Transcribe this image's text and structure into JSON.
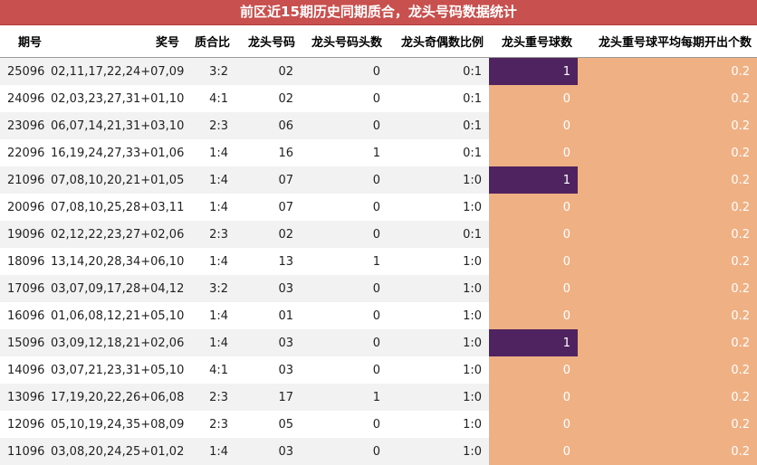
{
  "title": "前区近15期历史同期质合，龙头号码数据统计",
  "headers": [
    "期号",
    "奖号",
    "质合比",
    "龙头号码",
    "龙头号码头数",
    "龙头奇偶数比例",
    "龙头重号球数",
    "龙头重号球平均每期开出个数"
  ],
  "rows": [
    [
      "25096",
      "02,11,17,22,24+07,09",
      "3:2",
      "02",
      "0",
      "0:1",
      "1",
      "0.2"
    ],
    [
      "24096",
      "02,03,23,27,31+01,10",
      "4:1",
      "02",
      "0",
      "0:1",
      "0",
      "0.2"
    ],
    [
      "23096",
      "06,07,14,21,31+03,10",
      "2:3",
      "06",
      "0",
      "0:1",
      "0",
      "0.2"
    ],
    [
      "22096",
      "16,19,24,27,33+01,06",
      "1:4",
      "16",
      "1",
      "0:1",
      "0",
      "0.2"
    ],
    [
      "21096",
      "07,08,10,20,21+01,05",
      "1:4",
      "07",
      "0",
      "1:0",
      "1",
      "0.2"
    ],
    [
      "20096",
      "07,08,10,25,28+03,11",
      "1:4",
      "07",
      "0",
      "1:0",
      "0",
      "0.2"
    ],
    [
      "19096",
      "02,12,22,23,27+02,06",
      "2:3",
      "02",
      "0",
      "0:1",
      "0",
      "0.2"
    ],
    [
      "18096",
      "13,14,20,28,34+06,10",
      "1:4",
      "13",
      "1",
      "1:0",
      "0",
      "0.2"
    ],
    [
      "17096",
      "03,07,09,17,28+04,12",
      "3:2",
      "03",
      "0",
      "1:0",
      "0",
      "0.2"
    ],
    [
      "16096",
      "01,06,08,12,21+05,10",
      "1:4",
      "01",
      "0",
      "1:0",
      "0",
      "0.2"
    ],
    [
      "15096",
      "03,09,12,18,21+02,06",
      "1:4",
      "03",
      "0",
      "1:0",
      "1",
      "0.2"
    ],
    [
      "14096",
      "03,07,21,23,31+05,10",
      "4:1",
      "03",
      "0",
      "1:0",
      "0",
      "0.2"
    ],
    [
      "13096",
      "17,19,20,22,26+06,08",
      "2:3",
      "17",
      "1",
      "1:0",
      "0",
      "0.2"
    ],
    [
      "12096",
      "05,10,19,24,35+08,09",
      "2:3",
      "05",
      "0",
      "1:0",
      "0",
      "0.2"
    ],
    [
      "11096",
      "03,08,20,24,25+01,02",
      "1:4",
      "03",
      "0",
      "1:0",
      "0",
      "0.2"
    ]
  ],
  "colors": {
    "title_bg": "#c8504e",
    "hit_cell": "#4f2360",
    "base_cell": "#efb184",
    "stripe": "#f2f2f2"
  }
}
